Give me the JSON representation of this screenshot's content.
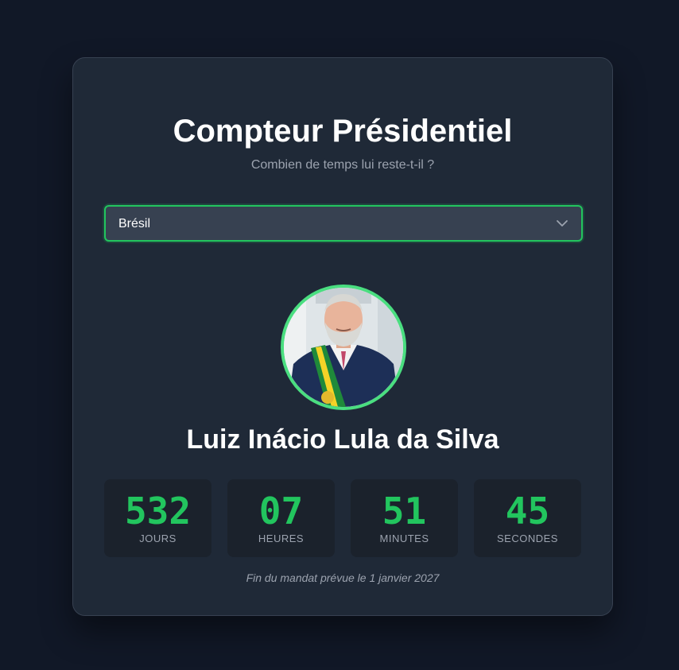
{
  "header": {
    "title": "Compteur Présidentiel",
    "subtitle": "Combien de temps lui reste-t-il ?"
  },
  "country_select": {
    "selected": "Brésil",
    "icon": "chevron-down-icon"
  },
  "president": {
    "name": "Luiz Inácio Lula da Silva",
    "photo": "president-portrait"
  },
  "countdown": [
    {
      "value": "532",
      "label": "JOURS"
    },
    {
      "value": "07",
      "label": "HEURES"
    },
    {
      "value": "51",
      "label": "MINUTES"
    },
    {
      "value": "45",
      "label": "SECONDES"
    }
  ],
  "footer": {
    "note": "Fin du mandat prévue le 1 janvier 2027"
  },
  "colors": {
    "background": "#111827",
    "card": "#1f2937",
    "accent": "#22c55e",
    "text": "#ffffff",
    "muted": "#9ca3af"
  }
}
